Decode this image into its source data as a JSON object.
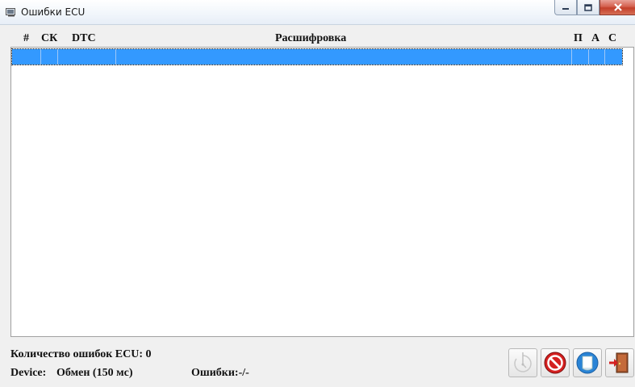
{
  "window": {
    "title": "Ошибки ECU"
  },
  "grid": {
    "columns": [
      "#",
      "СК",
      "DTC",
      "Расшифровка",
      "П",
      "А",
      "С"
    ],
    "selection_color": "#3399ff"
  },
  "status": {
    "count_label": "Количество ошибок ECU: 0",
    "device_label": "Device:",
    "device_value": "Обмен (150 мс)",
    "errors_label": "Ошибки:-/-"
  },
  "toolbar": {
    "icons": [
      "timer-icon",
      "stop-icon",
      "clear-icon",
      "exit-icon"
    ]
  }
}
